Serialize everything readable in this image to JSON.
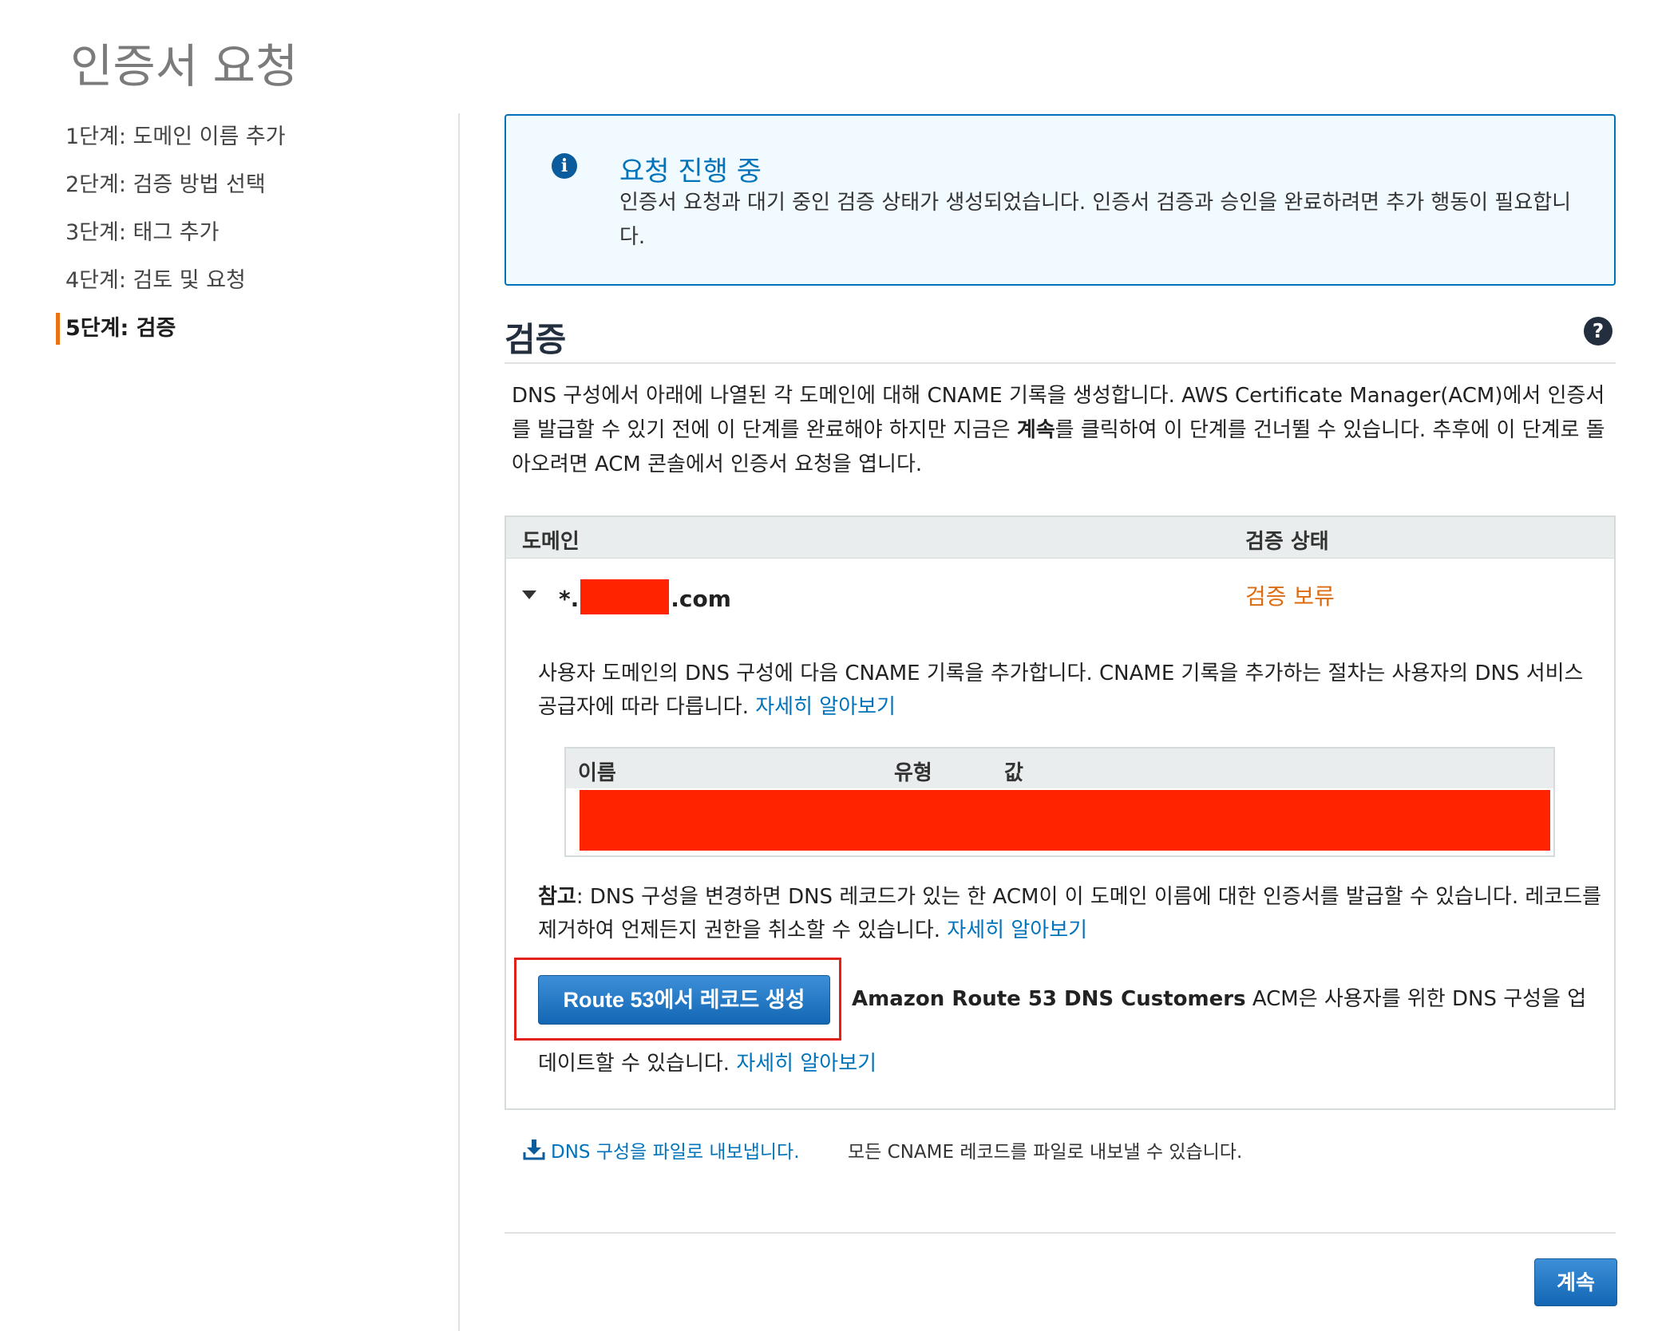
{
  "page_title": "인증서 요청",
  "steps": [
    {
      "label": "1단계: 도메인 이름 추가"
    },
    {
      "label": "2단계: 검증 방법 선택"
    },
    {
      "label": "3단계: 태그 추가"
    },
    {
      "label": "4단계: 검토 및 요청"
    },
    {
      "label": "5단계: 검증",
      "active": true
    }
  ],
  "alert": {
    "icon": "info-icon",
    "title": "요청 진행 중",
    "text": "인증서 요청과 대기 중인 검증 상태가 생성되었습니다. 인증서 검증과 승인을 완료하려면 추가 행동이 필요합니다."
  },
  "section": {
    "title": "검증",
    "help_icon": "help-icon",
    "intro_before": "DNS 구성에서 아래에 나열된 각 도메인에 대해 CNAME 기록을 생성합니다. AWS Certificate Manager(ACM)에서 인증서를 발급할 수 있기 전에 이 단계를 완료해야 하지만 지금은 ",
    "intro_bold": "계속",
    "intro_after": "를 클릭하여 이 단계를 건너뛸 수 있습니다. 추후에 이 단계로 돌아오려면 ACM 콘솔에서 인증서 요청을 엽니다."
  },
  "table": {
    "col_domain": "도메인",
    "col_status": "검증 상태",
    "row": {
      "domain_prefix": "*.",
      "domain_suffix": ".com",
      "status": "검증 보류"
    },
    "detail_text": "사용자 도메인의 DNS 구성에 다음 CNAME 기록을 추가합니다. CNAME 기록을 추가하는 절차는 사용자의 DNS 서비스 공급자에 따라 다릅니다.",
    "learn_more": "자세히 알아보기",
    "inner_headers": {
      "name": "이름",
      "type": "유형",
      "value": "값"
    },
    "note_bold": "참고",
    "note_text": ": DNS 구성을 변경하면 DNS 레코드가 있는 한 ACM이 이 도메인 이름에 대한 인증서를 발급할 수 있습니다. 레코드를 제거하여 언제든지 권한을 취소할 수 있습니다.",
    "route53_button": "Route 53에서 레코드 생성",
    "route53_bold": "Amazon Route 53 DNS Customers",
    "route53_text": " ACM은 사용자를 위한 DNS 구성을 업",
    "route53_text2": "데이트할 수 있습니다."
  },
  "export": {
    "icon": "download-icon",
    "link": "DNS 구성을 파일로 내보냅니다.",
    "description": "모든 CNAME 레코드를 파일로 내보낼 수 있습니다."
  },
  "continue_button": "계속",
  "colors": {
    "accent_blue": "#0073bb",
    "pending_orange": "#dd6b10",
    "active_step_bar": "#ec7211",
    "redaction": "#ff2300",
    "highlight_border": "#e0221b"
  }
}
